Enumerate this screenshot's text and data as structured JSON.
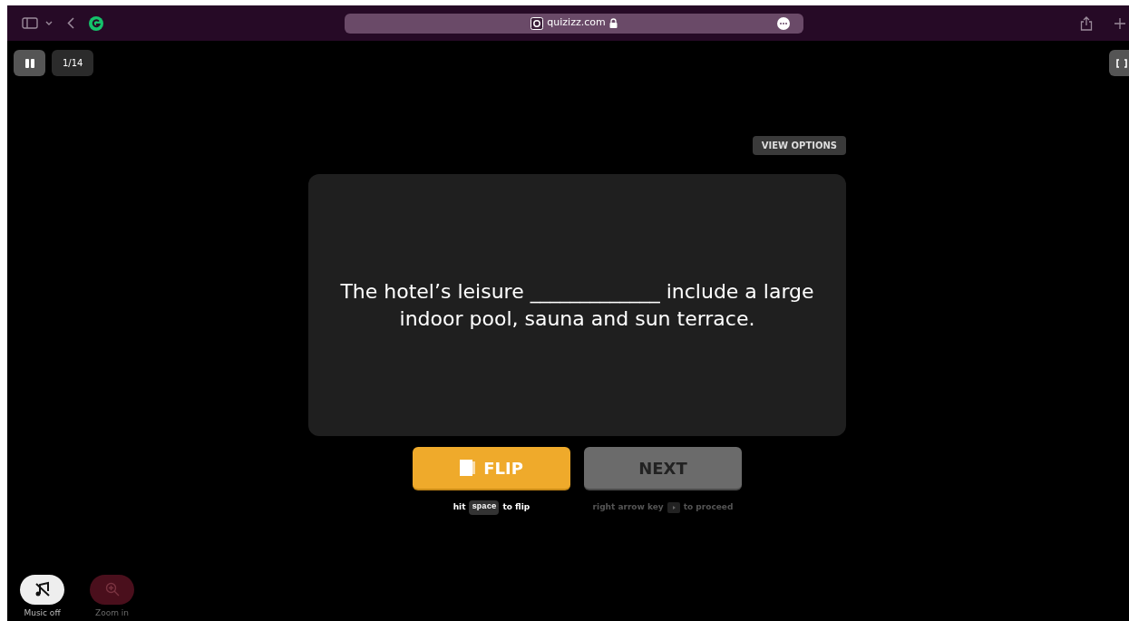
{
  "browser": {
    "url": "quizizz.com"
  },
  "top_bar": {
    "counter": "1/14"
  },
  "view_options": "VIEW OPTIONS",
  "card": {
    "text": "The hotel’s leisure _____________ include a large indoor pool, sauna and sun terrace."
  },
  "buttons": [
    {
      "kind": "flip",
      "label": "FLIP"
    },
    {
      "kind": "next",
      "label": "NEXT"
    }
  ],
  "hints": [
    {
      "before": "hit",
      "key": "space",
      "after": "to flip",
      "disabled": false
    },
    {
      "before": "right arrow key",
      "after": "to proceed",
      "disabled": true
    }
  ],
  "bottom_controls": [
    {
      "kind": "music",
      "label": "Music off",
      "disabled": false
    },
    {
      "kind": "zoom",
      "label": "Zoom in",
      "disabled": true
    }
  ]
}
